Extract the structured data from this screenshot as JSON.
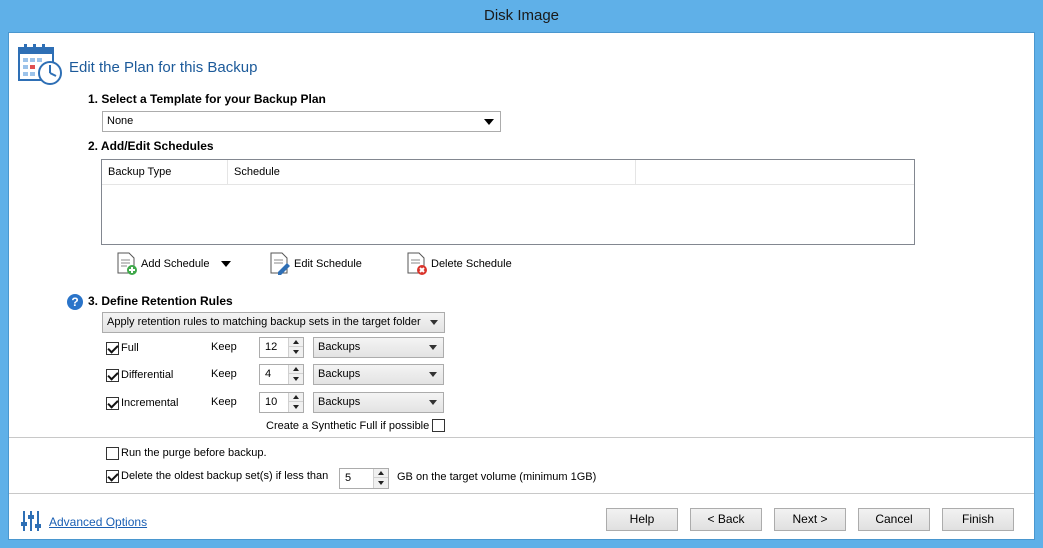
{
  "window": {
    "title": "Disk Image"
  },
  "header": {
    "title": "Edit the Plan for this Backup",
    "icon": "calendar-clock-icon"
  },
  "template": {
    "label": "1. Select a Template for your Backup Plan",
    "selected": "None"
  },
  "schedules": {
    "label": "2. Add/Edit Schedules",
    "columns": [
      "Backup Type",
      "Schedule"
    ],
    "rows": [],
    "add_label": "Add Schedule",
    "edit_label": "Edit Schedule",
    "delete_label": "Delete Schedule"
  },
  "retention": {
    "label": "3. Define Retention Rules",
    "mode": "Apply retention rules to matching backup sets in the target folder",
    "keep_label": "Keep",
    "rules": [
      {
        "name": "Full",
        "checked": true,
        "keep": "12",
        "unit": "Backups"
      },
      {
        "name": "Differential",
        "checked": true,
        "keep": "4",
        "unit": "Backups"
      },
      {
        "name": "Incremental",
        "checked": true,
        "keep": "10",
        "unit": "Backups"
      }
    ],
    "synthetic_full_label": "Create a Synthetic Full if possible",
    "synthetic_full_checked": false
  },
  "purge": {
    "label": "Run the purge before backup.",
    "checked": false
  },
  "delete_oldest": {
    "label": "Delete the oldest backup set(s) if less than",
    "checked": true,
    "value": "5",
    "suffix": "GB on the target volume (minimum 1GB)"
  },
  "footer": {
    "advanced_label": "Advanced Options",
    "help": "Help",
    "back": "< Back",
    "next": "Next >",
    "cancel": "Cancel",
    "finish": "Finish"
  },
  "colors": {
    "title_bar": "#5fb0e8",
    "accent_text": "#1c5a9a",
    "link": "#1a5fb4"
  }
}
